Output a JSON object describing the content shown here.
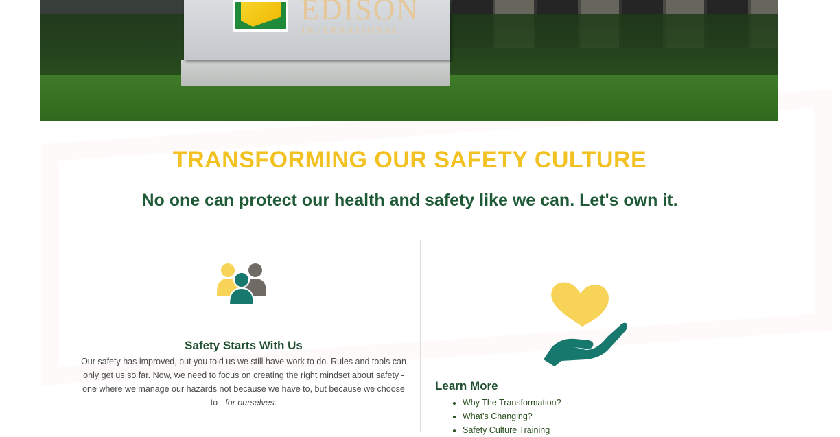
{
  "hero": {
    "brand_name": "EDISON",
    "brand_sub": "INTERNATIONAL"
  },
  "page": {
    "title": "TRANSFORMING OUR SAFETY CULTURE",
    "subtitle": "No one can protect our health and safety like we can. Let's own it."
  },
  "left_card": {
    "icon": "people-group-icon",
    "title": "Safety Starts With Us",
    "body_main": "Our safety has improved, but you told us we still have work to do. Rules and tools can only get us so far. Now, we need to focus on creating the right mindset about safety - one where we manage our hazards not because we have to, but because we choose to - ",
    "body_emphasis": "for ourselves."
  },
  "right_card": {
    "icon": "heart-in-hand-icon",
    "learn_more_title": "Learn More",
    "links": [
      "Why The Transformation?",
      "What's Changing?",
      "Safety Culture Training"
    ]
  },
  "colors": {
    "title_yellow": "#f2c122",
    "subtitle_green": "#1f5a37",
    "icon_yellow": "#f7d358",
    "icon_teal": "#17786e",
    "icon_gray": "#6f6a64"
  }
}
